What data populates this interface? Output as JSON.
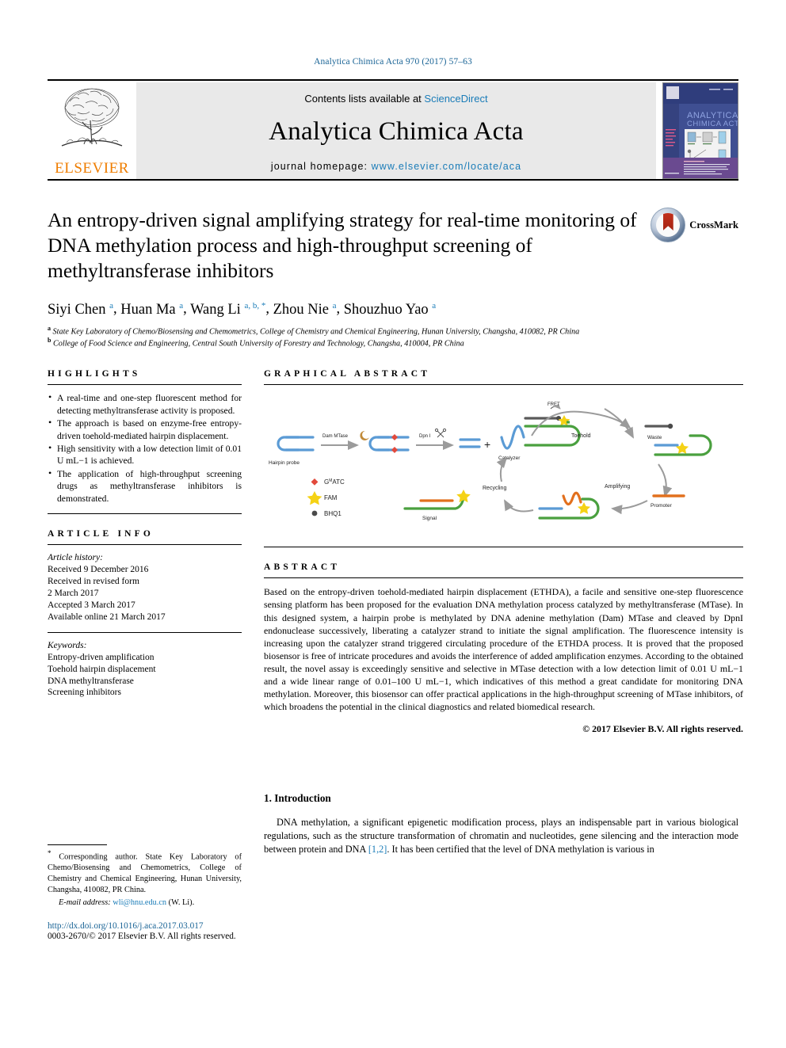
{
  "running_head": "Analytica Chimica Acta 970 (2017) 57–63",
  "masthead": {
    "contents_prefix": "Contents lists available at ",
    "contents_link": "ScienceDirect",
    "journal_title": "Analytica Chimica Acta",
    "homepage_prefix": "journal homepage: ",
    "homepage_url": "www.elsevier.com/locate/aca",
    "publisher": "ELSEVIER",
    "cover_title_line1": "ANALYTICA",
    "cover_title_line2": "CHIMICA ACTA"
  },
  "article": {
    "title": "An entropy-driven signal amplifying strategy for real-time monitoring of DNA methylation process and high-throughput screening of methyltransferase inhibitors",
    "crossmark_label": "CrossMark",
    "authors": [
      {
        "name": "Siyi Chen",
        "marks": "a"
      },
      {
        "name": "Huan Ma",
        "marks": "a"
      },
      {
        "name": "Wang Li",
        "marks": "a, b, *"
      },
      {
        "name": "Zhou Nie",
        "marks": "a"
      },
      {
        "name": "Shouzhuo Yao",
        "marks": "a"
      }
    ],
    "affiliations": [
      {
        "mark": "a",
        "text": "State Key Laboratory of Chemo/Biosensing and Chemometrics, College of Chemistry and Chemical Engineering, Hunan University, Changsha, 410082, PR China"
      },
      {
        "mark": "b",
        "text": "College of Food Science and Engineering, Central South University of Forestry and Technology, Changsha, 410004, PR China"
      }
    ]
  },
  "highlights": {
    "heading": "HIGHLIGHTS",
    "items": [
      "A real-time and one-step fluorescent method for detecting methyltransferase activity is proposed.",
      "The approach is based on enzyme-free entropy-driven toehold-mediated hairpin displacement.",
      "High sensitivity with a low detection limit of 0.01 U mL−1 is achieved.",
      "The application of high-throughput screening drugs as methyltransferase inhibitors is demonstrated."
    ]
  },
  "article_info": {
    "heading": "ARTICLE INFO",
    "history_label": "Article history:",
    "history": [
      "Received 9 December 2016",
      "Received in revised form",
      "2 March 2017",
      "Accepted 3 March 2017",
      "Available online 21 March 2017"
    ],
    "keywords_label": "Keywords:",
    "keywords": [
      "Entropy-driven amplification",
      "Toehold hairpin displacement",
      "DNA methyltransferase",
      "Screening inhibitors"
    ]
  },
  "graphical_abstract": {
    "heading": "GRAPHICAL ABSTRACT",
    "labels": {
      "hairpin_probe": "Hairpin probe",
      "dam_mtase": "Dam MTase",
      "dpn1": "Dpn I",
      "catalyzer": "Catalyzer",
      "fret": "FRET",
      "waste": "Waste",
      "toehold": "Toehold",
      "amplifying": "Amplifying",
      "recycling": "Recycling",
      "promoter": "Promoter",
      "signal": "Signal"
    },
    "legend": [
      {
        "symbol": "diamond",
        "color": "#e24a3c",
        "label": "GᴹATC"
      },
      {
        "symbol": "star",
        "color": "#f5d215",
        "label": "FAM"
      },
      {
        "symbol": "circle",
        "color": "#5a5a5a",
        "label": "BHQ1"
      }
    ],
    "colors": {
      "probe_blue": "#5b9bd5",
      "strand_green": "#4aa03f",
      "promoter_orange": "#e2701e",
      "arrow_gray": "#9b9b9b"
    }
  },
  "abstract": {
    "heading": "ABSTRACT",
    "body": "Based on the entropy-driven toehold-mediated hairpin displacement (ETHDA), a facile and sensitive one-step fluorescence sensing platform has been proposed for the evaluation DNA methylation process catalyzed by methyltransferase (MTase). In this designed system, a hairpin probe is methylated by DNA adenine methylation (Dam) MTase and cleaved by DpnI endonuclease successively, liberating a catalyzer strand to initiate the signal amplification. The fluorescence intensity is increasing upon the catalyzer strand triggered circulating procedure of the ETHDA process. It is proved that the proposed biosensor is free of intricate procedures and avoids the interference of added amplification enzymes. According to the obtained result, the novel assay is exceedingly sensitive and selective in MTase detection with a low detection limit of 0.01 U mL−1 and a wide linear range of 0.01–100 U mL−1, which indicatives of this method a great candidate for monitoring DNA methylation. Moreover, this biosensor can offer practical applications in the high-throughput screening of MTase inhibitors, of which broadens the potential in the clinical diagnostics and related biomedical research.",
    "copyright": "© 2017 Elsevier B.V. All rights reserved."
  },
  "introduction": {
    "heading": "1. Introduction",
    "paragraph_part1": "DNA methylation, a significant epigenetic modification process, plays an indispensable part in various biological regulations, such as the structure transformation of chromatin and nucleotides, gene silencing and the interaction mode between protein and DNA ",
    "reference": "[1,2]",
    "paragraph_part2": ". It has been certified that the level of DNA methylation is various in"
  },
  "footer": {
    "corresponding_marker": "*",
    "corresponding_text": " Corresponding author. State Key Laboratory of Chemo/Biosensing and Chemometrics, College of Chemistry and Chemical Engineering, Hunan University, Changsha, 410082, PR China.",
    "email_label": "E-mail address:",
    "email": "wli@hnu.edu.cn",
    "email_owner": "(W. Li).",
    "doi": "http://dx.doi.org/10.1016/j.aca.2017.03.017",
    "issn_line": "0003-2670/© 2017 Elsevier B.V. All rights reserved."
  }
}
